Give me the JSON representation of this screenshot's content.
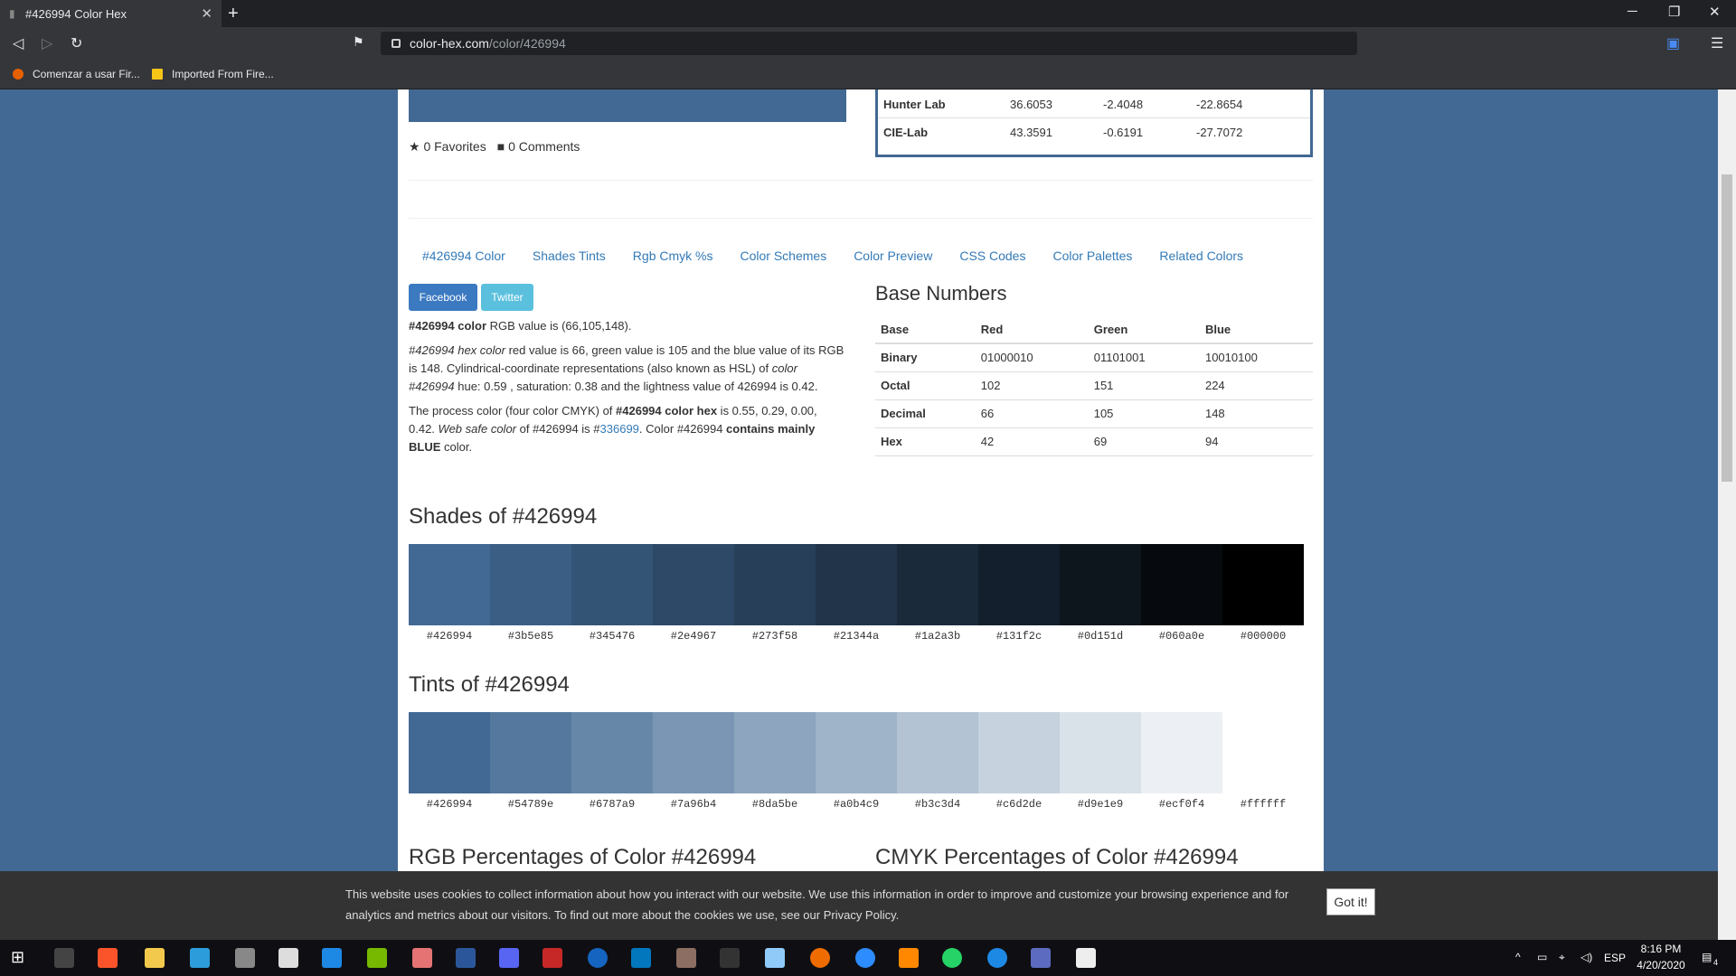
{
  "browser": {
    "tab_title": "#426994 Color Hex",
    "url_host": "color-hex.com",
    "url_path": "/color/426994",
    "bookmarks": [
      "Comenzar a usar Fir...",
      "Imported From Fire..."
    ]
  },
  "meta": {
    "favorites": "0 Favorites",
    "comments": "0 Comments"
  },
  "conversion_rows": [
    {
      "name": "Hunter Lab",
      "a": "36.6053",
      "b": "-2.4048",
      "c": "-22.8654"
    },
    {
      "name": "CIE-Lab",
      "a": "43.3591",
      "b": "-0.6191",
      "c": "-27.7072"
    }
  ],
  "nav_links": [
    "#426994 Color",
    "Shades Tints",
    "Rgb Cmyk %s",
    "Color Schemes",
    "Color Preview",
    "CSS Codes",
    "Color Palettes",
    "Related Colors"
  ],
  "share": {
    "facebook": "Facebook",
    "twitter": "Twitter"
  },
  "description": {
    "p1_bold": "#426994 color",
    "p1_rest": " RGB value is (66,105,148).",
    "p2_em1": "#426994 hex color",
    "p2_text1": " red value is 66, green value is 105 and the blue value of its RGB is 148. Cylindrical-coordinate representations (also known as HSL) of ",
    "p2_em2": "color #426994",
    "p2_text2": " hue: 0.59 , saturation: 0.38 and the lightness value of 426994 is 0.42.",
    "p3_text1": "The process color (four color CMYK) of ",
    "p3_bold1": "#426994 color hex",
    "p3_text2": " is 0.55, 0.29, 0.00, 0.42. ",
    "p3_em": "Web safe color",
    "p3_text3": " of #426994 is #",
    "p3_link": "336699",
    "p3_text4": ". Color #426994 ",
    "p3_bold2": "contains mainly BLUE",
    "p3_text5": " color."
  },
  "base_numbers": {
    "title": "Base Numbers",
    "headers": [
      "Base",
      "Red",
      "Green",
      "Blue"
    ],
    "rows": [
      [
        "Binary",
        "01000010",
        "01101001",
        "10010100"
      ],
      [
        "Octal",
        "102",
        "151",
        "224"
      ],
      [
        "Decimal",
        "66",
        "105",
        "148"
      ],
      [
        "Hex",
        "42",
        "69",
        "94"
      ]
    ]
  },
  "shades": {
    "title": "Shades of #426994",
    "colors": [
      "#426994",
      "#3b5e85",
      "#345476",
      "#2e4967",
      "#273f58",
      "#21344a",
      "#1a2a3b",
      "#131f2c",
      "#0d151d",
      "#060a0e",
      "#000000"
    ]
  },
  "tints": {
    "title": "Tints of #426994",
    "colors": [
      "#426994",
      "#54789e",
      "#6787a9",
      "#7a96b4",
      "#8da5be",
      "#a0b4c9",
      "#b3c3d4",
      "#c6d2de",
      "#d9e1e9",
      "#ecf0f4",
      "#ffffff"
    ]
  },
  "section_titles": {
    "rgb": "RGB Percentages of Color #426994",
    "cmyk": "CMYK Percentages of Color #426994"
  },
  "cookie": {
    "text": "This website uses cookies to collect information about how you interact with our website. We use this information in order to improve and customize your browsing experience and for analytics and metrics about our visitors. To find out more about the cookies we use, see our Privacy Policy.",
    "button": "Got it!"
  },
  "taskbar": {
    "time": "8:16 PM",
    "date": "4/20/2020",
    "lang": "ESP",
    "notifications": "4"
  }
}
